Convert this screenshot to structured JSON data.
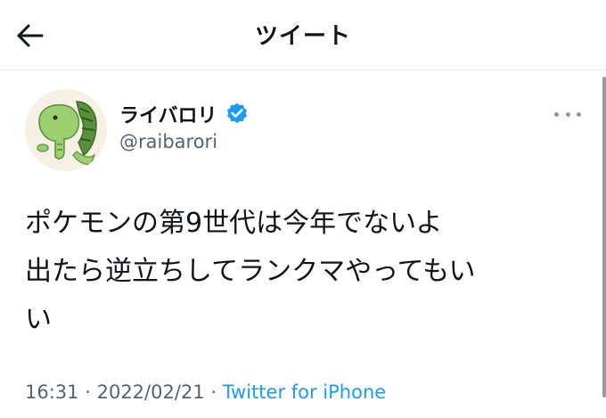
{
  "header": {
    "title": "ツイート",
    "back_icon": "arrow-left-icon"
  },
  "author": {
    "name": "ライバロリ",
    "handle": "@raibarori",
    "verified_icon": "verified-badge-icon",
    "verified_color": "#1d9bf0"
  },
  "more_icon": "more-horizontal-icon",
  "tweet": {
    "lines": [
      "ポケモンの第9世代は今年でないよ",
      "出たら逆立ちしてランクマやってもい",
      "い"
    ]
  },
  "meta": {
    "time": "16:31",
    "separator": "·",
    "date": "2022/02/21",
    "source": "Twitter for iPhone"
  },
  "colors": {
    "text": "#0f1419",
    "secondary": "#536471",
    "link": "#1d9bf0"
  }
}
